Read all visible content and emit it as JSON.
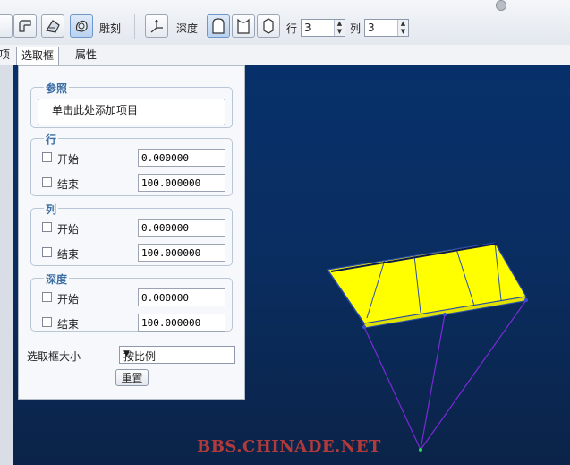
{
  "toolbar": {
    "engrave_label": "雕刻",
    "depth_label": "深度",
    "rows_label": "行",
    "rows_value": "3",
    "cols_label": "列",
    "cols_value": "3"
  },
  "tabs": {
    "partial": "项",
    "selection_box": "选取框",
    "properties": "属性"
  },
  "panel": {
    "reference": {
      "legend": "参照",
      "placeholder": "单击此处添加项目"
    },
    "row": {
      "legend": "行",
      "start_label": "开始",
      "start_value": "0.000000",
      "end_label": "结束",
      "end_value": "100.000000"
    },
    "column": {
      "legend": "列",
      "start_label": "开始",
      "start_value": "0.000000",
      "end_label": "结束",
      "end_value": "100.000000"
    },
    "depth": {
      "legend": "深度",
      "start_label": "开始",
      "start_value": "0.000000",
      "end_label": "结束",
      "end_value": "100.000000"
    },
    "size_label": "选取框大小",
    "size_value": "按比例",
    "reset_label": "重置"
  },
  "viewport": {
    "watermark": "BBS.CHINADE.NET",
    "plate_color": "#ffff00",
    "line_color": "#7a2ad6"
  }
}
